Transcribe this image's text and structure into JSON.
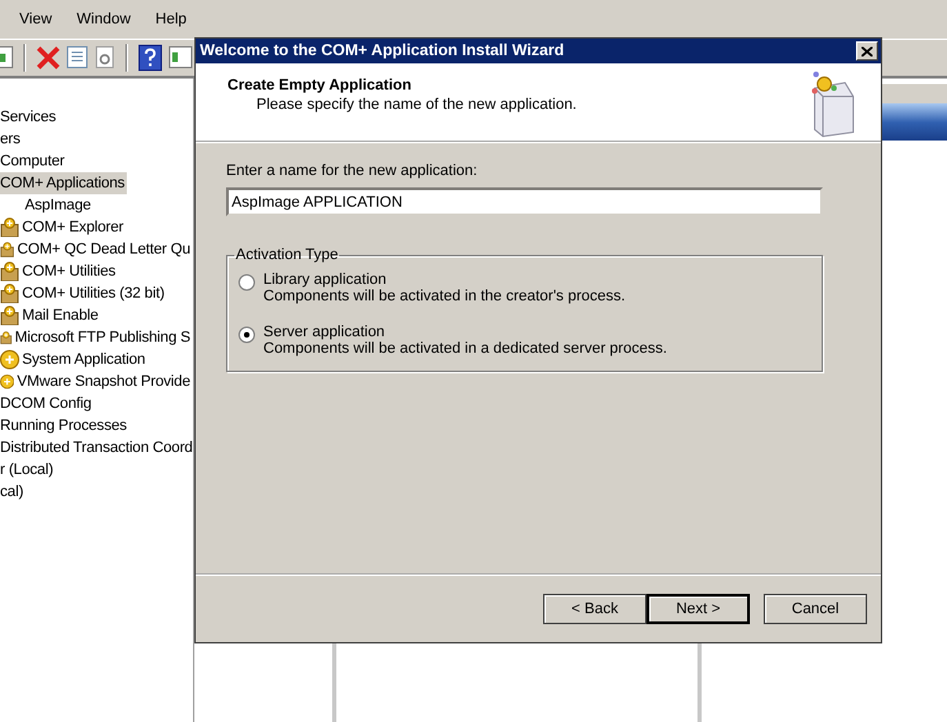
{
  "menu": [
    "View",
    "Window",
    "Help"
  ],
  "tree": [
    {
      "label": "Services",
      "selected": false
    },
    {
      "label": "ers",
      "selected": false
    },
    {
      "label": "Computer",
      "selected": false
    },
    {
      "label": "COM+ Applications",
      "selected": true,
      "children": [
        {
          "label": "AspImage",
          "kind": "plain",
          "selected": false
        },
        {
          "label": "COM+ Explorer",
          "kind": "package",
          "selected": false
        },
        {
          "label": "COM+ QC Dead Letter Qu",
          "kind": "package",
          "selected": false
        },
        {
          "label": "COM+ Utilities",
          "kind": "package",
          "selected": false
        },
        {
          "label": "COM+ Utilities (32 bit)",
          "kind": "package",
          "selected": false
        },
        {
          "label": "Mail Enable",
          "kind": "package",
          "selected": false
        },
        {
          "label": "Microsoft FTP Publishing S",
          "kind": "package",
          "selected": false
        },
        {
          "label": "System Application",
          "kind": "ball",
          "selected": false
        },
        {
          "label": "VMware Snapshot Provide",
          "kind": "ball",
          "selected": false
        }
      ]
    },
    {
      "label": "DCOM Config",
      "selected": false
    },
    {
      "label": "Running Processes",
      "selected": false
    },
    {
      "label": "Distributed Transaction Coord",
      "selected": false
    },
    {
      "label": "r (Local)",
      "selected": false
    },
    {
      "label": "cal)",
      "selected": false
    }
  ],
  "dialog": {
    "title": "Welcome to the COM+ Application Install Wizard",
    "heading": "Create Empty Application",
    "subheading": "Please specify the name of the new application.",
    "name_label": "Enter a name for the new application:",
    "name_value": "AspImage APPLICATION",
    "group_title": "Activation Type",
    "options": [
      {
        "label": "Library application",
        "description": "Components will be activated in the creator's process.",
        "selected": false
      },
      {
        "label": "Server application",
        "description": "Components will be activated in a dedicated server process.",
        "selected": true
      }
    ],
    "buttons": [
      {
        "label": "< Back",
        "default": false
      },
      {
        "label": "Next >",
        "default": true
      },
      {
        "label": "Cancel",
        "default": false
      }
    ]
  }
}
